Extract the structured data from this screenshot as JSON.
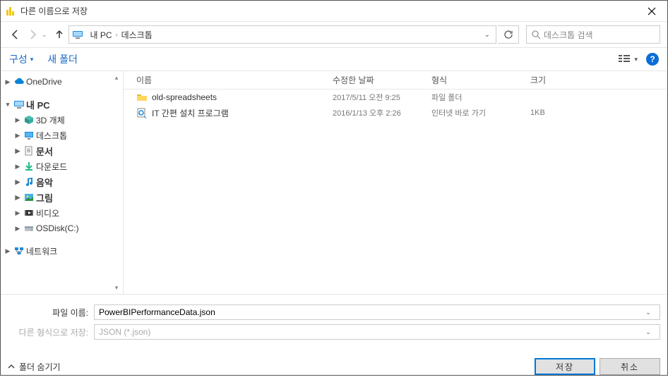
{
  "window": {
    "title": "다른 이름으로 저장"
  },
  "nav": {
    "crumb_root": "내 PC",
    "crumb_current": "데스크톱",
    "search_placeholder": "데스크톱 검색"
  },
  "toolbar": {
    "organize": "구성",
    "new_folder": "새 폴더"
  },
  "tree": [
    {
      "label": "OneDrive",
      "level": 1,
      "tgl": "▶",
      "icon": "cloud"
    },
    {
      "label": "내 PC",
      "level": 1,
      "tgl": "▾",
      "icon": "pc",
      "bold": true
    },
    {
      "label": "3D 개체",
      "level": 2,
      "tgl": "▶",
      "icon": "cube"
    },
    {
      "label": "데스크톱",
      "level": 2,
      "tgl": "▶",
      "icon": "desktop"
    },
    {
      "label": "문서",
      "level": 2,
      "tgl": "▶",
      "icon": "doc",
      "bold": true
    },
    {
      "label": "다운로드",
      "level": 2,
      "tgl": "▶",
      "icon": "download"
    },
    {
      "label": "음악",
      "level": 2,
      "tgl": "▶",
      "icon": "music",
      "bold": true
    },
    {
      "label": "그림",
      "level": 2,
      "tgl": "▶",
      "icon": "picture",
      "bold": true
    },
    {
      "label": "비디오",
      "level": 2,
      "tgl": "▶",
      "icon": "video"
    },
    {
      "label": "OSDisk(C:)",
      "level": 2,
      "tgl": "▶",
      "icon": "drive"
    },
    {
      "label": "네트워크",
      "level": 1,
      "tgl": "▶",
      "icon": "network"
    }
  ],
  "columns": {
    "name": "이름",
    "date": "수정한 날짜",
    "type": "형식",
    "size": "크기"
  },
  "files": [
    {
      "name": "old-spreadsheets",
      "date": "2017/5/11 오전 9:25",
      "type": "파일 폴더",
      "size": "",
      "icon": "folder"
    },
    {
      "name": "IT 간편 설치 프로그램",
      "date": "2016/1/13 오후 2:26",
      "type": "인터넷 바로 가기",
      "size": "1KB",
      "icon": "shortcut"
    }
  ],
  "fields": {
    "filename_label": "파일 이름:",
    "filename_value": "PowerBIPerformanceData.json",
    "type_label": "다른 형식으로 저장:",
    "type_value": "JSON (*.json)"
  },
  "footer": {
    "hide_folders": "폴더 숨기기",
    "save": "저장",
    "cancel": "취소"
  }
}
